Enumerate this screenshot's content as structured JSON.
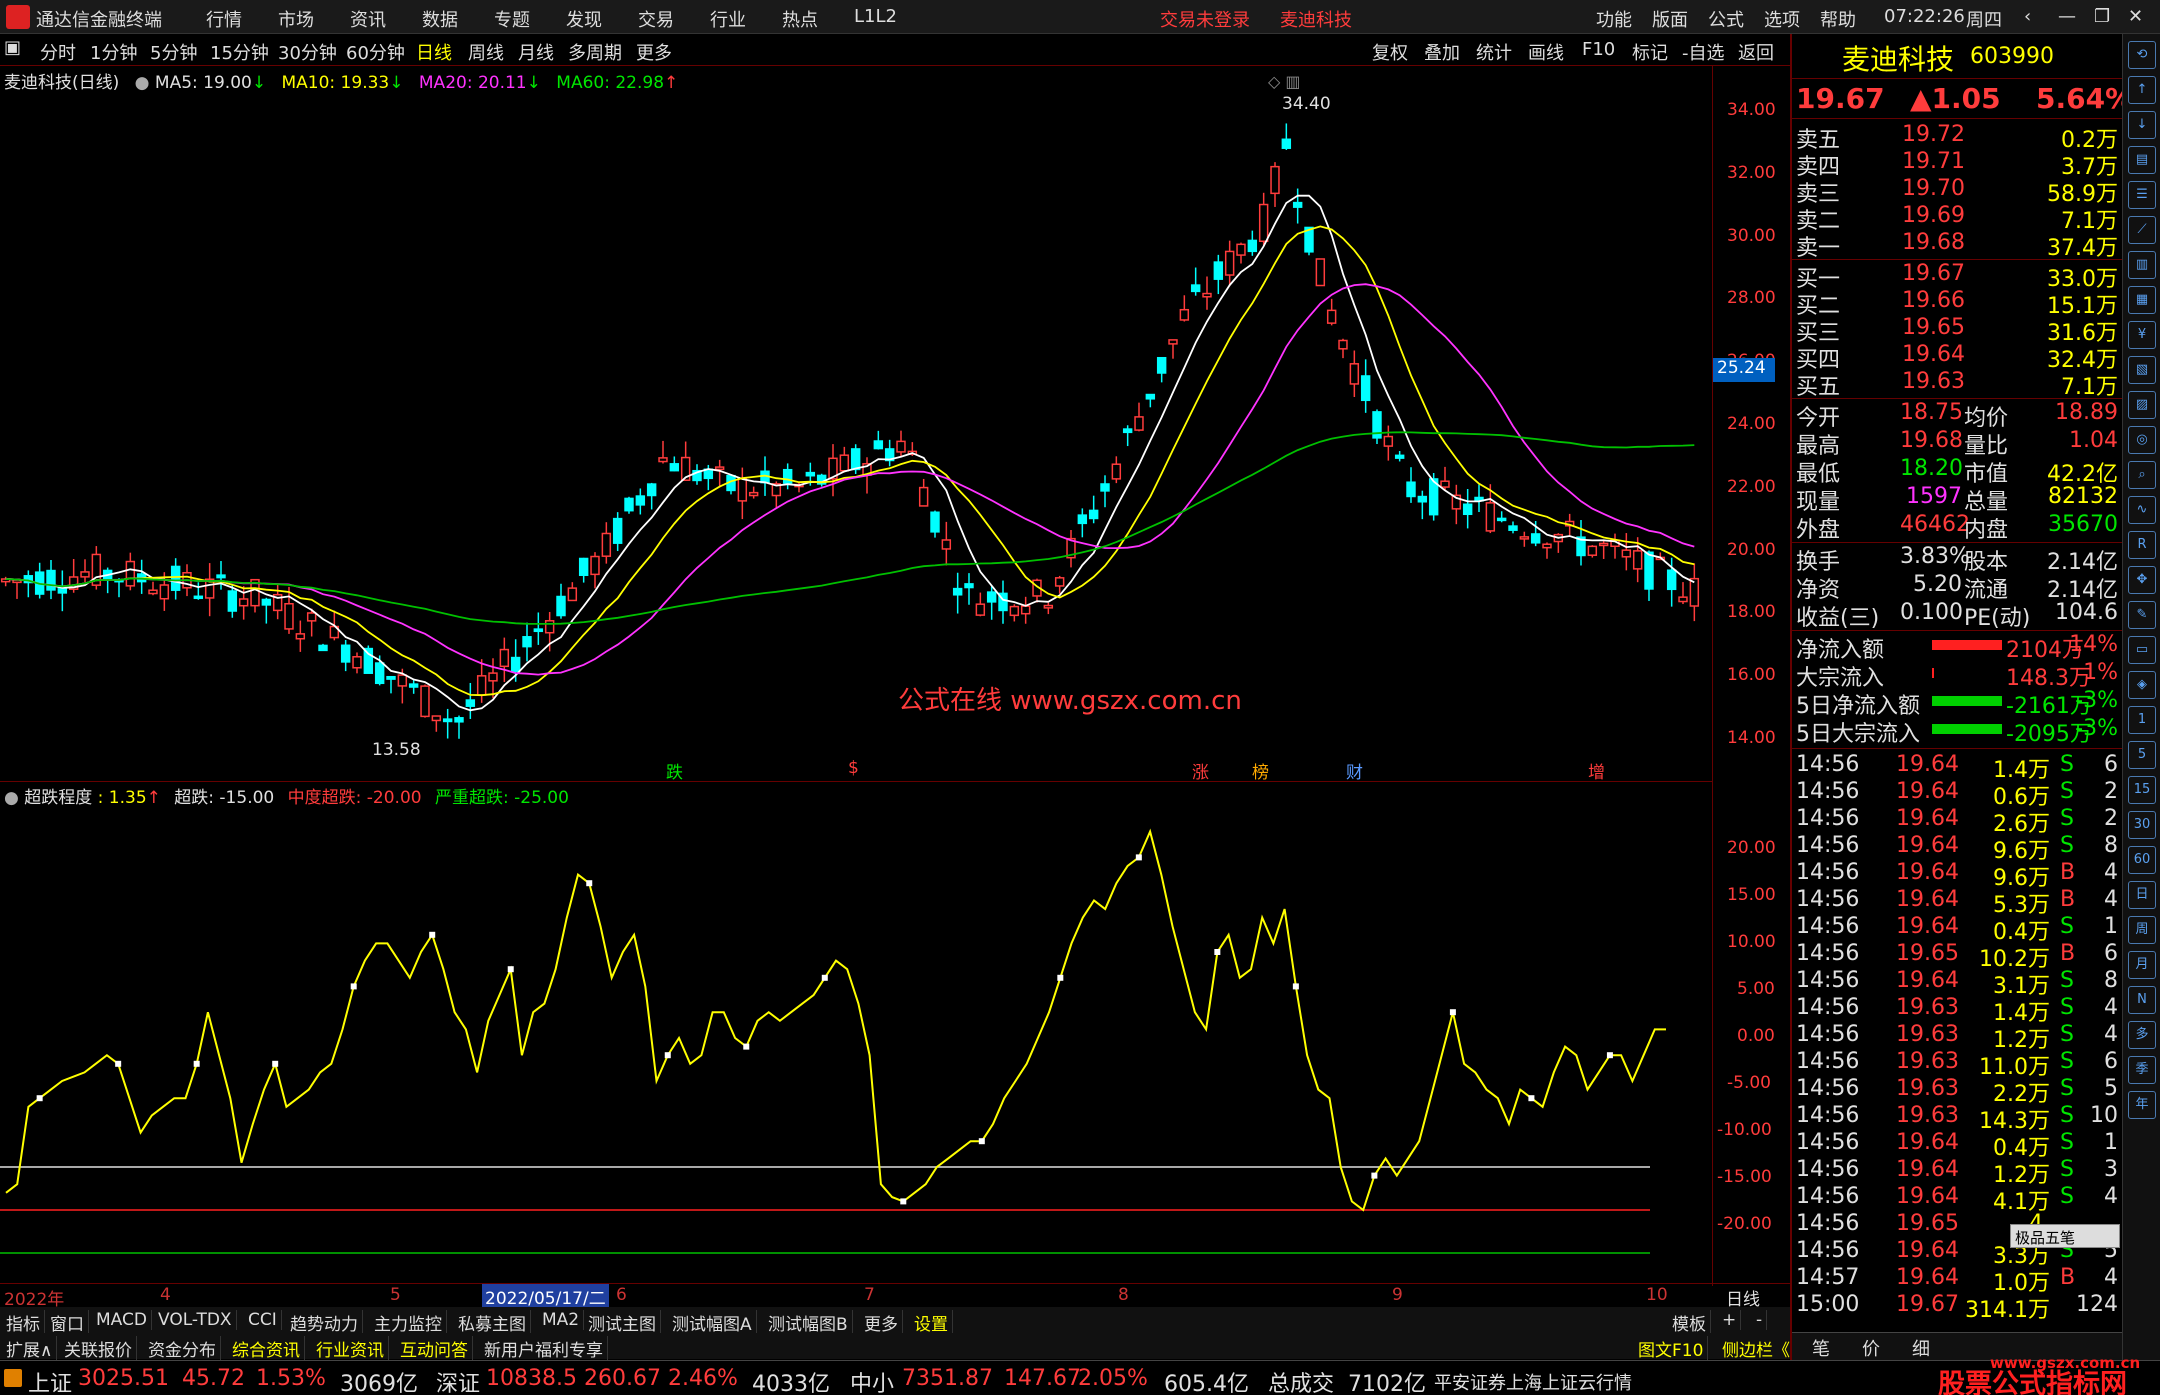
{
  "menubar": {
    "app_title": "通达信金融终端",
    "items": [
      "行情",
      "市场",
      "资讯",
      "数据",
      "专题",
      "发现",
      "交易",
      "行业",
      "热点",
      "L1L2"
    ],
    "trade_status": "交易未登录",
    "stock_name": "麦迪科技",
    "right_items": [
      "功能",
      "版面",
      "公式",
      "选项",
      "帮助"
    ],
    "time": "07:22:26",
    "weekday": "周四"
  },
  "periodbar": {
    "periods": [
      "分时",
      "1分钟",
      "5分钟",
      "15分钟",
      "30分钟",
      "60分钟",
      "日线",
      "周线",
      "月线",
      "多周期",
      "更多"
    ],
    "active": "日线",
    "tools": [
      "复权",
      "叠加",
      "统计",
      "画线",
      "F10",
      "标记",
      "-自选",
      "返回"
    ]
  },
  "main_chart": {
    "title": "麦迪科技(日线)",
    "ma5": "MA5: 19.00",
    "ma10": "MA10: 19.33",
    "ma20": "MA20: 20.11",
    "ma60": "MA60: 22.98",
    "high_label": "34.40",
    "low_label": "13.58",
    "watermark": "公式在线 www.gszx.com.cn",
    "current_price_tag": "25.24",
    "event_markers": [
      "跌",
      "$",
      "涨",
      "榜",
      "财",
      "增"
    ],
    "yticks": [
      "34.00",
      "32.00",
      "30.00",
      "28.00",
      "26.00",
      "24.00",
      "22.00",
      "20.00",
      "18.00",
      "16.00",
      "14.00"
    ]
  },
  "indicator": {
    "title": "超跌程度",
    "value": ": 1.35",
    "line1": "超跌: -15.00",
    "line2": "中度超跌: -20.00",
    "line3": "严重超跌: -25.00",
    "yticks": [
      "20.00",
      "15.00",
      "10.00",
      "5.00",
      "0.00",
      "-5.00",
      "-10.00",
      "-15.00",
      "-20.00"
    ]
  },
  "chart_data": [
    {
      "type": "line",
      "title": "超跌程度",
      "series": [
        {
          "name": "超跌程度",
          "values": [
            -18,
            -17,
            -8,
            -7,
            -6,
            -5,
            -4.5,
            -4,
            -3,
            -2,
            -3,
            -7,
            -11,
            -9,
            -8,
            -7,
            -7,
            -3,
            3,
            -2,
            -7,
            -14.5,
            -10,
            -6,
            -3,
            -8,
            -7,
            -6,
            -4,
            -3,
            1,
            6,
            9,
            11,
            11,
            9,
            7,
            10,
            12,
            8,
            3,
            1,
            -4,
            2,
            5,
            8,
            -2,
            3,
            4,
            8,
            14,
            19,
            18,
            13,
            7,
            10,
            12,
            6,
            -5,
            -2,
            0,
            -3,
            -2,
            3,
            3,
            0,
            -1,
            2,
            3,
            2,
            3,
            4,
            5,
            7,
            9,
            8,
            4,
            -2,
            -17,
            -18.5,
            -19,
            -18,
            -17,
            -15,
            -14,
            -13,
            -12,
            -12,
            -10,
            -7,
            -5,
            -3,
            0,
            3,
            7,
            11,
            14,
            16,
            15,
            18,
            20,
            21,
            24,
            19,
            13,
            8,
            3,
            1,
            10,
            12,
            7,
            8,
            14,
            11,
            15,
            6,
            -2,
            -6,
            -7,
            -15,
            -19,
            -20,
            -16,
            -14,
            -16,
            -14,
            -12,
            -7,
            -2,
            3,
            -3,
            -4,
            -6,
            -7,
            -10,
            -6,
            -7,
            -8,
            -4,
            -1,
            -2,
            -6,
            -4,
            -2,
            -2,
            -5,
            -2,
            1,
            1
          ],
          "color": "#ffff00"
        }
      ],
      "hlines": [
        {
          "name": "超跌",
          "value": -15,
          "color": "#e0e0e0"
        },
        {
          "name": "中度超跌",
          "value": -20,
          "color": "#ff2020"
        },
        {
          "name": "严重超跌",
          "value": -25,
          "color": "#00c000"
        }
      ],
      "ylim": [
        -25,
        25
      ]
    }
  ],
  "dateaxis": {
    "labels": [
      "2022年",
      "4",
      "5",
      "2022/05/17/二",
      "6",
      "7",
      "8",
      "9",
      "10"
    ],
    "period": "日线"
  },
  "tabs1": [
    "指标",
    "窗口",
    "MACD",
    "VOL-TDX",
    "CCI",
    "趋势动力",
    "主力监控",
    "私募主图",
    "MA2",
    "测试主图",
    "测试幅图A",
    "测试幅图B",
    "更多",
    "设置"
  ],
  "tabs1_right": [
    "模板",
    "+",
    "-"
  ],
  "tabs2": [
    "扩展∧",
    "关联报价",
    "资金分布",
    "综合资讯",
    "行业资讯",
    "互动问答",
    "新用户福利专享"
  ],
  "tabs2_right": [
    "图文F10",
    "侧边栏《"
  ],
  "right_panel": {
    "name": "麦迪科技",
    "code": "603990",
    "price": "19.67",
    "change": "▲1.05",
    "pct": "5.64%",
    "asks": [
      {
        "label": "卖五",
        "price": "19.72",
        "vol": "0.2万"
      },
      {
        "label": "卖四",
        "price": "19.71",
        "vol": "3.7万"
      },
      {
        "label": "卖三",
        "price": "19.70",
        "vol": "58.9万"
      },
      {
        "label": "卖二",
        "price": "19.69",
        "vol": "7.1万"
      },
      {
        "label": "卖一",
        "price": "19.68",
        "vol": "37.4万"
      }
    ],
    "bids": [
      {
        "label": "买一",
        "price": "19.67",
        "vol": "33.0万"
      },
      {
        "label": "买二",
        "price": "19.66",
        "vol": "15.1万"
      },
      {
        "label": "买三",
        "price": "19.65",
        "vol": "31.6万"
      },
      {
        "label": "买四",
        "price": "19.64",
        "vol": "32.4万"
      },
      {
        "label": "买五",
        "price": "19.63",
        "vol": "7.1万"
      }
    ],
    "stats": [
      {
        "l1": "今开",
        "v1": "18.75",
        "l2": "均价",
        "v2": "18.89"
      },
      {
        "l1": "最高",
        "v1": "19.68",
        "l2": "量比",
        "v2": "1.04"
      },
      {
        "l1": "最低",
        "v1": "18.20",
        "l2": "市值",
        "v2": "42.2亿"
      },
      {
        "l1": "现量",
        "v1": "1597",
        "l2": "总量",
        "v2": "82132"
      },
      {
        "l1": "外盘",
        "v1": "46462",
        "l2": "内盘",
        "v2": "35670"
      }
    ],
    "stats2": [
      {
        "l1": "换手",
        "v1": "3.83%",
        "l2": "股本",
        "v2": "2.14亿"
      },
      {
        "l1": "净资",
        "v1": "5.20",
        "l2": "流通",
        "v2": "2.14亿"
      },
      {
        "l1": "收益(三)",
        "v1": "0.100",
        "l2": "PE(动)",
        "v2": "104.6"
      }
    ],
    "flows": [
      {
        "label": "净流入额",
        "value": "2104万",
        "pct": "14%"
      },
      {
        "label": "大宗流入",
        "value": "148.3万",
        "pct": "1%"
      },
      {
        "label": "5日净流入额",
        "value": "-2161万",
        "pct": "-3%"
      },
      {
        "label": "5日大宗流入",
        "value": "-2095万",
        "pct": "-3%"
      }
    ],
    "ticks": [
      {
        "t": "14:56",
        "p": "19.64",
        "v": "1.4万",
        "s": "S",
        "n": "6"
      },
      {
        "t": "14:56",
        "p": "19.64",
        "v": "0.6万",
        "s": "S",
        "n": "2"
      },
      {
        "t": "14:56",
        "p": "19.64",
        "v": "2.6万",
        "s": "S",
        "n": "2"
      },
      {
        "t": "14:56",
        "p": "19.64",
        "v": "9.6万",
        "s": "S",
        "n": "8"
      },
      {
        "t": "14:56",
        "p": "19.64",
        "v": "9.6万",
        "s": "B",
        "n": "4"
      },
      {
        "t": "14:56",
        "p": "19.64",
        "v": "5.3万",
        "s": "B",
        "n": "4"
      },
      {
        "t": "14:56",
        "p": "19.64",
        "v": "0.4万",
        "s": "S",
        "n": "1"
      },
      {
        "t": "14:56",
        "p": "19.65",
        "v": "10.2万",
        "s": "B",
        "n": "6"
      },
      {
        "t": "14:56",
        "p": "19.64",
        "v": "3.1万",
        "s": "S",
        "n": "8"
      },
      {
        "t": "14:56",
        "p": "19.63",
        "v": "1.4万",
        "s": "S",
        "n": "4"
      },
      {
        "t": "14:56",
        "p": "19.63",
        "v": "1.2万",
        "s": "S",
        "n": "4"
      },
      {
        "t": "14:56",
        "p": "19.63",
        "v": "11.0万",
        "s": "S",
        "n": "6"
      },
      {
        "t": "14:56",
        "p": "19.63",
        "v": "2.2万",
        "s": "S",
        "n": "5"
      },
      {
        "t": "14:56",
        "p": "19.63",
        "v": "14.3万",
        "s": "S",
        "n": "10"
      },
      {
        "t": "14:56",
        "p": "19.64",
        "v": "0.4万",
        "s": "S",
        "n": "1"
      },
      {
        "t": "14:56",
        "p": "19.64",
        "v": "1.2万",
        "s": "S",
        "n": "3"
      },
      {
        "t": "14:56",
        "p": "19.64",
        "v": "4.1万",
        "s": "S",
        "n": "4"
      },
      {
        "t": "14:56",
        "p": "19.65",
        "v": "4.",
        "s": "",
        "n": ""
      },
      {
        "t": "14:56",
        "p": "19.64",
        "v": "3.3万",
        "s": "S",
        "n": "5"
      },
      {
        "t": "14:57",
        "p": "19.64",
        "v": "1.0万",
        "s": "B",
        "n": "4"
      },
      {
        "t": "15:00",
        "p": "19.67",
        "v": "314.1万",
        "s": "",
        "n": "124"
      }
    ],
    "popup": "极品五笔",
    "bottom_tabs": [
      "笔",
      "价",
      "细"
    ]
  },
  "statusbar": {
    "sh_label": "上证",
    "sh_val": "3025.51",
    "sh_chg": "45.72",
    "sh_pct": "1.53%",
    "sh_amt": "3069亿",
    "sz_label": "深证",
    "sz_val": "10838.5",
    "sz_chg": "260.67",
    "sz_pct": "2.46%",
    "sz_amt": "4033亿",
    "zx_label": "中小",
    "zx_val": "7351.87",
    "zx_chg": "147.67",
    "zx_pct": "2.05%",
    "zx_amt": "605.4亿",
    "total_label": "总成交",
    "total_val": "7102亿",
    "broker": "平安证券上海上证云行情",
    "brand": "股票公式指标网",
    "brand_url": "www.gszx.com.cn"
  },
  "colors": {
    "up": "#ff3c3c",
    "down": "#00e600",
    "ma5": "#ffffff",
    "ma10": "#ffff00",
    "ma20": "#ff33ff",
    "ma60": "#00c000"
  }
}
